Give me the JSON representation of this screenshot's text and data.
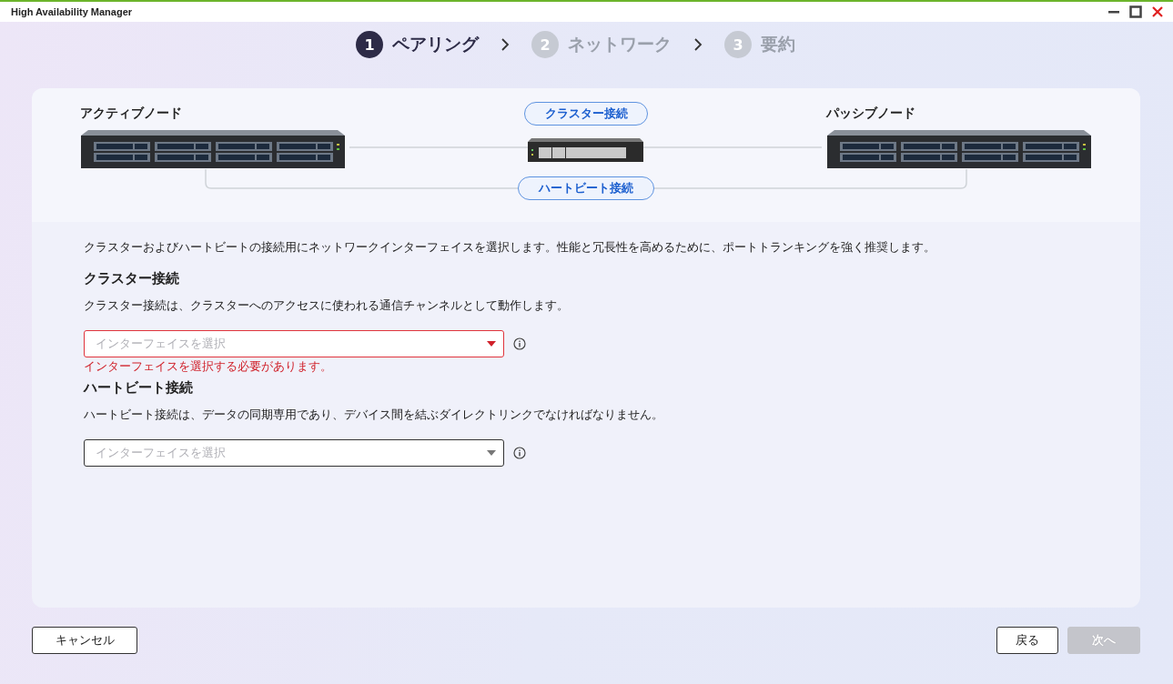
{
  "window": {
    "title": "High Availability Manager"
  },
  "steps": [
    {
      "number": "1",
      "label": "ペアリング",
      "selected": true
    },
    {
      "number": "2",
      "label": "ネットワーク",
      "selected": false
    },
    {
      "number": "3",
      "label": "要約",
      "selected": false
    }
  ],
  "diagram": {
    "active_node": "アクティブノード",
    "passive_node": "パッシブノード",
    "cluster_link": "クラスター接続",
    "heartbeat_link": "ハートビート接続"
  },
  "intro": "クラスターおよびハートビートの接続用にネットワークインターフェイスを選択します。性能と冗長性を高めるために、ポートトランキングを強く推奨します。",
  "sections": [
    {
      "heading": "クラスター接続",
      "description": "クラスター接続は、クラスターへのアクセスに使われる通信チャンネルとして動作します。",
      "placeholder": "インターフェイスを選択",
      "error": true,
      "error_message": "インターフェイスを選択する必要があります。"
    },
    {
      "heading": "ハートビート接続",
      "description": "ハートビート接続は、データの同期専用であり、デバイス間を結ぶダイレクトリンクでなければなりません。",
      "placeholder": "インターフェイスを選択",
      "error": false
    }
  ],
  "buttons": [
    {
      "label": "キャンセル",
      "disabled": false
    },
    {
      "label": "戻る",
      "disabled": false
    },
    {
      "label": "次へ",
      "disabled": true
    }
  ]
}
